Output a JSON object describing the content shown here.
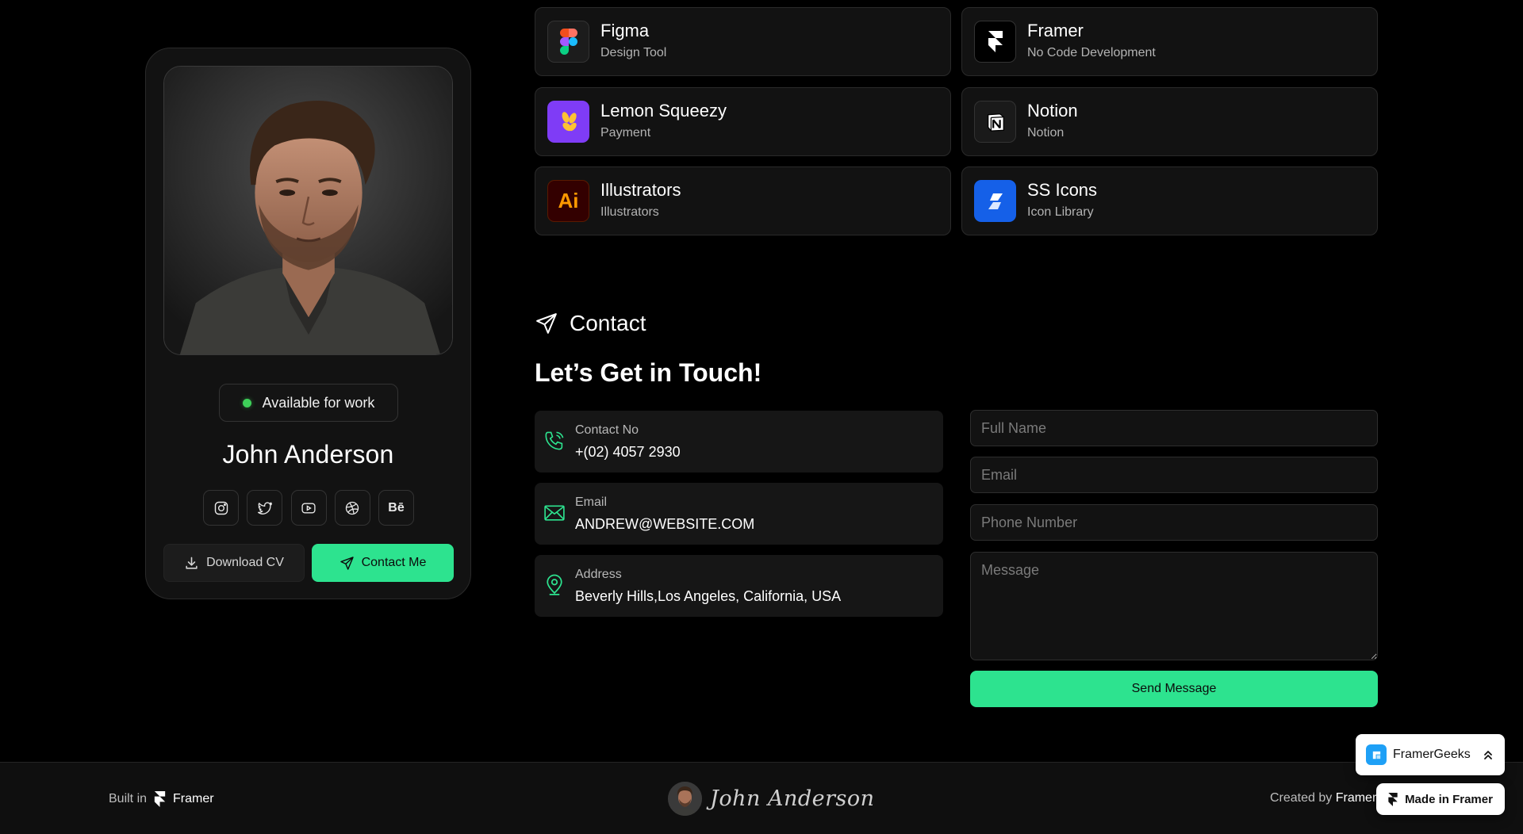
{
  "profile": {
    "availability": "Available for work",
    "name": "John Anderson",
    "social_icons": [
      "instagram-icon",
      "twitter-icon",
      "youtube-icon",
      "dribbble-icon",
      "behance-icon"
    ],
    "behance_glyph": "Bē",
    "download_label": "Download CV",
    "contact_label": "Contact Me",
    "status_color": "#3ed159",
    "accent": "#2de38f"
  },
  "tools": [
    {
      "name": "Figma",
      "subtitle": "Design Tool",
      "icon": "figma-logo"
    },
    {
      "name": "Framer",
      "subtitle": "No Code Development",
      "icon": "framer-logo"
    },
    {
      "name": "Lemon Squeezy",
      "subtitle": "Payment",
      "icon": "lemon-squeezy-logo"
    },
    {
      "name": "Notion",
      "subtitle": "Notion",
      "icon": "notion-logo"
    },
    {
      "name": "Illustrators",
      "subtitle": "Illustrators",
      "icon": "illustrator-logo"
    },
    {
      "name": "SS Icons",
      "subtitle": "Icon Library",
      "icon": "ss-icons-logo"
    }
  ],
  "illustrator_glyph": "Ai",
  "contact": {
    "section_title": "Contact",
    "heading": "Let’s Get in Touch!",
    "info": [
      {
        "label": "Contact No",
        "value": "+(02) 4057 2930",
        "icon": "phone-icon"
      },
      {
        "label": "Email",
        "value": "ANDREW@WEBSITE.COM",
        "icon": "mail-icon"
      },
      {
        "label": "Address",
        "value": "Beverly Hills,Los Angeles, California, USA",
        "icon": "map-pin-icon"
      }
    ],
    "form": {
      "full_name_placeholder": "Full Name",
      "email_placeholder": "Email",
      "phone_placeholder": "Phone Number",
      "message_placeholder": "Message",
      "send_label": "Send Message"
    }
  },
  "footer": {
    "built_in": "Built in",
    "built_brand": "Framer",
    "signature": "John Anderson",
    "created_by": "Created by",
    "created_brand": "Framer"
  },
  "badges": {
    "framergeeks": "FramerGeeks",
    "made_in": "Made in Framer"
  }
}
